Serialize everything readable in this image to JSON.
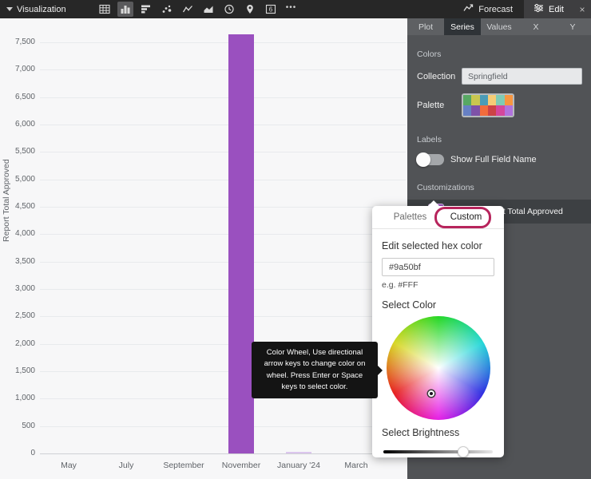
{
  "toolbar": {
    "title": "Visualization",
    "chart_type_icons": [
      {
        "name": "table-icon",
        "selected": false
      },
      {
        "name": "column-chart-icon",
        "selected": true
      },
      {
        "name": "bar-chart-icon",
        "selected": false
      },
      {
        "name": "scatter-icon",
        "selected": false
      },
      {
        "name": "line-chart-icon",
        "selected": false
      },
      {
        "name": "area-chart-icon",
        "selected": false
      },
      {
        "name": "timeline-icon",
        "selected": false
      },
      {
        "name": "map-pin-icon",
        "selected": false
      },
      {
        "name": "single-value-icon",
        "selected": false,
        "label": "6"
      },
      {
        "name": "more-icon",
        "selected": false,
        "label": "•••"
      }
    ],
    "forecast_label": "Forecast",
    "edit_label": "Edit",
    "close_label": "×"
  },
  "chart_data": {
    "type": "bar",
    "ylabel": "Report Total Approved",
    "y_ticks": [
      0,
      500,
      1000,
      1500,
      2000,
      2500,
      3000,
      3500,
      4000,
      4500,
      5000,
      5500,
      6000,
      6500,
      7000,
      7500
    ],
    "y_tick_labels": [
      "0",
      "500",
      "1,000",
      "1,500",
      "2,000",
      "2,500",
      "3,000",
      "3,500",
      "4,000",
      "4,500",
      "5,000",
      "5,500",
      "6,000",
      "6,500",
      "7,000",
      "7,500"
    ],
    "x_tick_labels": [
      "May",
      "July",
      "September",
      "November",
      "January '24",
      "March"
    ],
    "ylim": [
      0,
      7730
    ],
    "grid": true,
    "bars": [
      {
        "month_index": 6,
        "value": 7640,
        "color": "#9a50bf"
      },
      {
        "month_index": 8,
        "value": 30,
        "color": "#dcc6ee"
      }
    ]
  },
  "panel": {
    "tabs": [
      {
        "label": "Plot",
        "active": false
      },
      {
        "label": "Series",
        "active": true
      },
      {
        "label": "Values",
        "active": false
      },
      {
        "label": "X",
        "active": false
      },
      {
        "label": "Y",
        "active": false
      }
    ],
    "colors_section": {
      "header": "Colors",
      "collection_label": "Collection",
      "collection_value": "Springfield",
      "palette_label": "Palette",
      "palette_colors": [
        "#57a863",
        "#c9c74f",
        "#4b9cb7",
        "#f6cc76",
        "#7fcbb5",
        "#f79640",
        "#6680c4",
        "#7e52a8",
        "#f26c3c",
        "#cc4346",
        "#d4479c",
        "#b172dd"
      ]
    },
    "labels_section": {
      "header": "Labels",
      "toggle_label": "Show Full Field Name",
      "toggle_on": false
    },
    "customizations_section": {
      "header": "Customizations",
      "series_name": "Sum of Report Total Approved",
      "series_color": "#9a50bf"
    }
  },
  "popover": {
    "tabs": [
      {
        "label": "Palettes",
        "active": false
      },
      {
        "label": "Custom",
        "active": true
      }
    ],
    "hex_heading": "Edit selected hex color",
    "hex_value": "#9a50bf",
    "hex_hint": "e.g. #FFF",
    "select_color_label": "Select Color",
    "select_brightness_label": "Select Brightness",
    "brightness_percent": 72,
    "annotation_color": "#b7245c"
  },
  "tooltip": {
    "text": "Color Wheel, Use directional arrow keys to change color on wheel. Press Enter or Space keys to select color."
  }
}
